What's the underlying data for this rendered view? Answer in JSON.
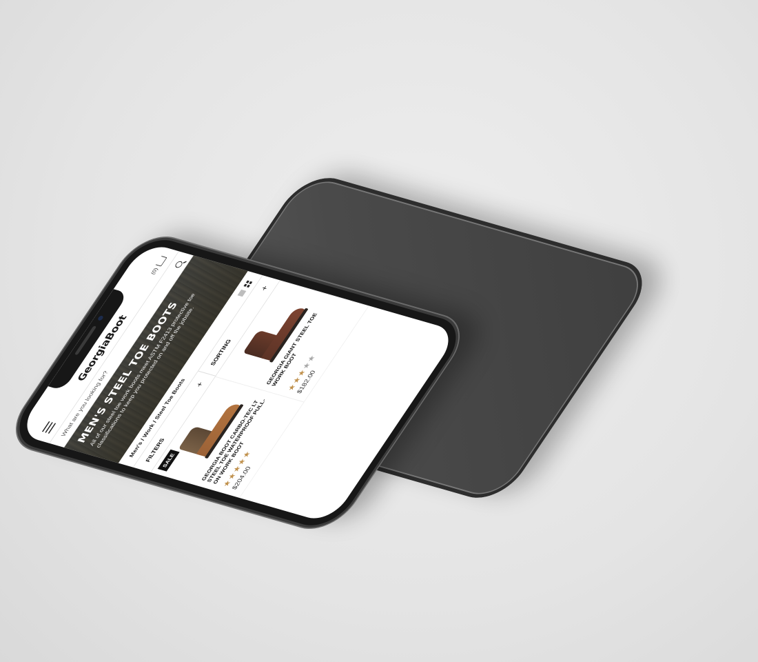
{
  "header": {
    "logo": "GeorgiaBoot",
    "cart_count": "(0)"
  },
  "search": {
    "placeholder": "What are you looking for?"
  },
  "hero": {
    "title": "MEN'S STEEL TOE BOOTS",
    "description": "All of our steel toe work boots meet ASTM F2413 protective toe classifications to keep you protected on and off the jobsite."
  },
  "breadcrumb": "Men's / Work / Steel Toe Boots",
  "filters": {
    "filters_label": "FILTERS",
    "sorting_label": "SORTING",
    "plus": "+"
  },
  "products": [
    {
      "name": "GEORGIA BOOT CARBO-TEC LT STEEL TOE WATERPROOF PULL-ON WORK BOOT",
      "price": "$204.00",
      "rating": 5,
      "badge": "SALE"
    },
    {
      "name": "GEORGIA GIANT STEEL TOE WORK BOOT",
      "price": "$182.00",
      "rating": 3,
      "badge": ""
    }
  ],
  "colors": {
    "star_on": "#c0914d",
    "star_off": "#a8a8a8",
    "badge_bg": "#111111"
  }
}
